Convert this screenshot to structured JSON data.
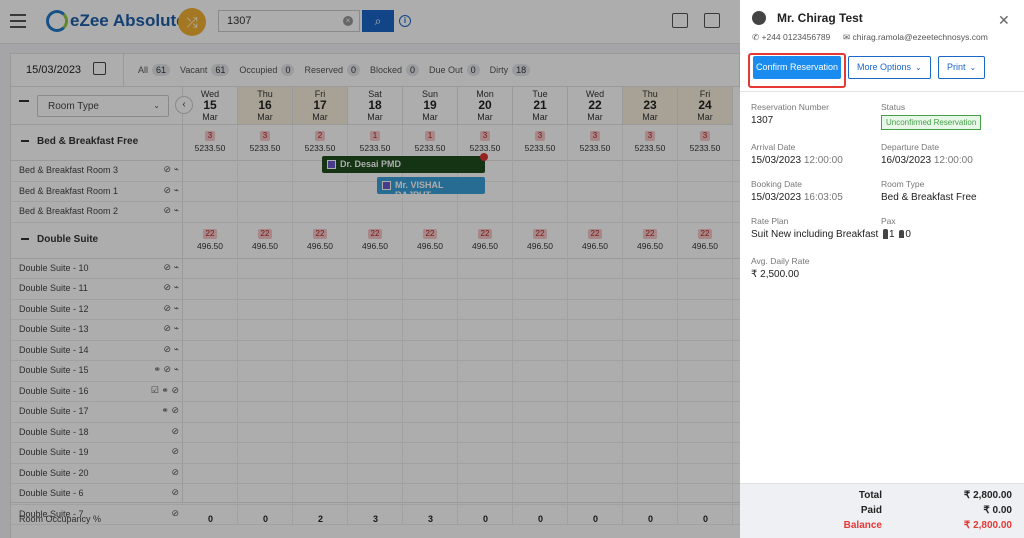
{
  "app": {
    "name": "eZee Absolute",
    "search_value": "1307"
  },
  "stats": {
    "date": "15/03/2023",
    "items": [
      {
        "label": "All",
        "count": "61"
      },
      {
        "label": "Vacant",
        "count": "61"
      },
      {
        "label": "Occupied",
        "count": "0"
      },
      {
        "label": "Reserved",
        "count": "0"
      },
      {
        "label": "Blocked",
        "count": "0"
      },
      {
        "label": "Due Out",
        "count": "0"
      },
      {
        "label": "Dirty",
        "count": "18"
      }
    ]
  },
  "grid": {
    "room_type_label": "Room Type",
    "days": [
      {
        "dow": "Wed",
        "day": "15",
        "mon": "Mar",
        "weekend": false
      },
      {
        "dow": "Thu",
        "day": "16",
        "mon": "Mar",
        "weekend": true
      },
      {
        "dow": "Fri",
        "day": "17",
        "mon": "Mar",
        "weekend": true
      },
      {
        "dow": "Sat",
        "day": "18",
        "mon": "Mar",
        "weekend": false
      },
      {
        "dow": "Sun",
        "day": "19",
        "mon": "Mar",
        "weekend": false
      },
      {
        "dow": "Mon",
        "day": "20",
        "mon": "Mar",
        "weekend": false
      },
      {
        "dow": "Tue",
        "day": "21",
        "mon": "Mar",
        "weekend": false
      },
      {
        "dow": "Wed",
        "day": "22",
        "mon": "Mar",
        "weekend": false
      },
      {
        "dow": "Thu",
        "day": "23",
        "mon": "Mar",
        "weekend": true
      },
      {
        "dow": "Fri",
        "day": "24",
        "mon": "Mar",
        "weekend": true
      }
    ],
    "categories": [
      {
        "name": "Bed & Breakfast Free",
        "avail": [
          "3",
          "3",
          "2",
          "1",
          "1",
          "3",
          "3",
          "3",
          "3",
          "3"
        ],
        "rate": "5233.50",
        "rooms": [
          {
            "name": "Bed & Breakfast Room 3",
            "icons": "⊘ ⌁"
          },
          {
            "name": "Bed & Breakfast Room 1",
            "icons": "⊘ ⌁"
          },
          {
            "name": "Bed & Breakfast Room 2",
            "icons": "⊘ ⌁"
          }
        ]
      },
      {
        "name": "Double Suite",
        "avail": [
          "22",
          "22",
          "22",
          "22",
          "22",
          "22",
          "22",
          "22",
          "22",
          "22"
        ],
        "rate": "496.50",
        "rooms": [
          {
            "name": "Double Suite - 10",
            "icons": "⊘ ⌁"
          },
          {
            "name": "Double Suite - 11",
            "icons": "⊘ ⌁"
          },
          {
            "name": "Double Suite - 12",
            "icons": "⊘ ⌁"
          },
          {
            "name": "Double Suite - 13",
            "icons": "⊘ ⌁"
          },
          {
            "name": "Double Suite - 14",
            "icons": "⊘ ⌁"
          },
          {
            "name": "Double Suite - 15",
            "icons": "⚭ ⊘ ⌁"
          },
          {
            "name": "Double Suite - 16",
            "icons": "☑ ⚭ ⊘"
          },
          {
            "name": "Double Suite - 17",
            "icons": "⚭ ⊘"
          },
          {
            "name": "Double Suite - 18",
            "icons": "⊘"
          },
          {
            "name": "Double Suite - 19",
            "icons": "⊘"
          },
          {
            "name": "Double Suite - 20",
            "icons": "⊘"
          },
          {
            "name": "Double Suite - 6",
            "icons": "⊘"
          },
          {
            "name": "Double Suite - 7",
            "icons": "⊘"
          }
        ]
      }
    ],
    "bookings": [
      {
        "guest": "Dr. Desai PMD",
        "color": "#1e4d1e"
      },
      {
        "guest": "Mr. VISHAL RAJPUT",
        "color": "#3aa0d8"
      }
    ],
    "occupancy_label": "Room Occupancy %",
    "occupancy": [
      "0",
      "0",
      "2",
      "3",
      "3",
      "0",
      "0",
      "0",
      "0",
      "0"
    ]
  },
  "panel": {
    "guest_name": "Mr. Chirag Test",
    "phone": "+244 0123456789",
    "email": "chirag.ramola@ezeetechnosys.com",
    "buttons": {
      "confirm": "Confirm Reservation",
      "more": "More Options",
      "print": "Print"
    },
    "fields": {
      "res_no_label": "Reservation Number",
      "res_no": "1307",
      "status_label": "Status",
      "status": "Unconfirmed Reservation",
      "arrival_label": "Arrival Date",
      "arrival_date": "15/03/2023",
      "arrival_time": "12:00:00",
      "departure_label": "Departure Date",
      "departure_date": "16/03/2023",
      "departure_time": "12:00:00",
      "booking_label": "Booking Date",
      "booking_date": "15/03/2023",
      "booking_time": "16:03:05",
      "roomtype_label": "Room Type",
      "roomtype": "Bed & Breakfast Free",
      "rateplan_label": "Rate Plan",
      "rateplan": "Suit New including Breakfast",
      "pax_label": "Pax",
      "pax_adult": "1",
      "pax_child": "0",
      "adr_label": "Avg. Daily Rate",
      "adr": "₹ 2,500.00"
    },
    "totals": {
      "total_label": "Total",
      "total": "₹ 2,800.00",
      "paid_label": "Paid",
      "paid": "₹ 0.00",
      "balance_label": "Balance",
      "balance": "₹ 2,800.00"
    }
  },
  "colors": {
    "accent": "#1a66c9",
    "confirm": "#1a8cf0",
    "highlight": "#e53935",
    "status": "#43a047"
  }
}
